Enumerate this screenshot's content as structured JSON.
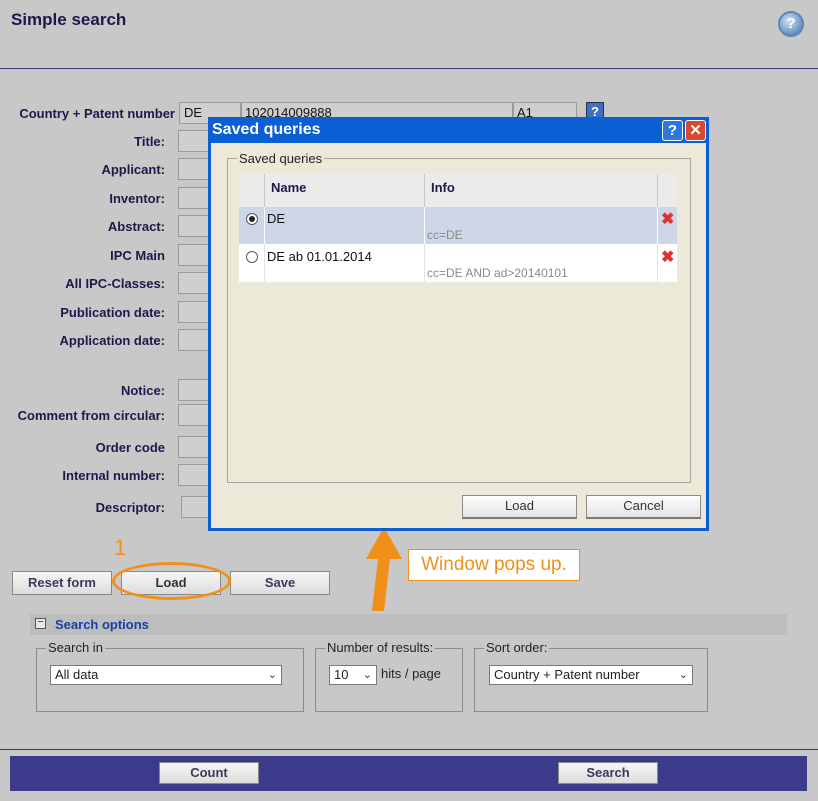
{
  "page": {
    "title": "Simple search",
    "help_icon": "question-icon"
  },
  "form": {
    "country_patent": {
      "label": "Country + Patent number",
      "country": "DE",
      "number": "102014009888",
      "kind": "A1"
    },
    "fields": [
      {
        "key": "title",
        "label": "Title:"
      },
      {
        "key": "applicant",
        "label": "Applicant:"
      },
      {
        "key": "inventor",
        "label": "Inventor:"
      },
      {
        "key": "abstract",
        "label": "Abstract:"
      },
      {
        "key": "ipc_main",
        "label": "IPC Main"
      },
      {
        "key": "all_ipc",
        "label": "All IPC-Classes:"
      },
      {
        "key": "pub_date",
        "label": "Publication date:"
      },
      {
        "key": "app_date",
        "label": "Application date:"
      },
      {
        "key": "notice",
        "label": "Notice:"
      },
      {
        "key": "comment",
        "label": "Comment from circular:"
      },
      {
        "key": "order_code",
        "label": "Order code"
      },
      {
        "key": "internal_number",
        "label": "Internal number:"
      },
      {
        "key": "descriptor",
        "label": "Descriptor:"
      }
    ],
    "buttons": {
      "reset": "Reset form",
      "load": "Load",
      "save": "Save"
    }
  },
  "annotation": {
    "step": "1",
    "callout": "Window pops up."
  },
  "search_options": {
    "header": "Search options",
    "collapse_icon": "minus-box-icon",
    "search_in": {
      "legend": "Search in",
      "value": "All data"
    },
    "num_results": {
      "legend": "Number of results:",
      "value": "10",
      "suffix": "hits / page"
    },
    "sort_order": {
      "legend": "Sort order:",
      "value": "Country + Patent number"
    }
  },
  "footer": {
    "count": "Count",
    "search": "Search"
  },
  "dialog": {
    "title": "Saved queries",
    "group_title": "Saved queries",
    "columns": {
      "name": "Name",
      "info": "Info"
    },
    "rows": [
      {
        "name": "DE",
        "info": "cc=DE",
        "selected": true
      },
      {
        "name": "DE ab 01.01.2014",
        "info": "cc=DE AND ad>20140101",
        "selected": false
      }
    ],
    "load": "Load",
    "cancel": "Cancel",
    "help": "?",
    "close": "✕"
  },
  "colors": {
    "accent": "#0a5fd4",
    "annotation": "#f0901a",
    "footer": "#3b3b8a"
  }
}
